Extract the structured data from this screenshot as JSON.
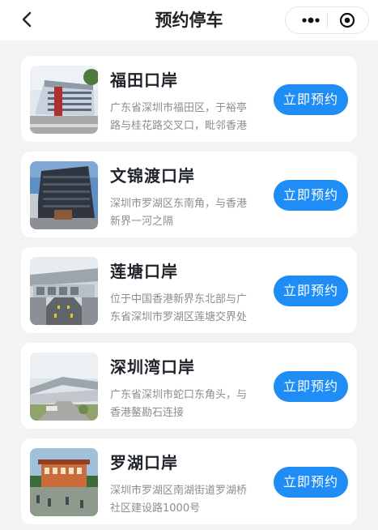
{
  "header": {
    "title": "预约停车"
  },
  "ports": [
    {
      "name": "福田口岸",
      "address": "广东省深圳市福田区，于裕亭路与桂花路交叉口，毗邻香港",
      "button": "立即预约"
    },
    {
      "name": "文锦渡口岸",
      "address": "深圳市罗湖区东南角，与香港新界一河之隔",
      "button": "立即预约"
    },
    {
      "name": "莲塘口岸",
      "address": "位于中国香港新界东北部与广东省深圳市罗湖区莲塘交界处",
      "button": "立即预约"
    },
    {
      "name": "深圳湾口岸",
      "address": "广东省深圳市蛇口东角头，与香港鳌勘石连接",
      "button": "立即预约"
    },
    {
      "name": "罗湖口岸",
      "address": "深圳市罗湖区南湖街道罗湖桥社区建设路1000号",
      "button": "立即预约"
    }
  ]
}
